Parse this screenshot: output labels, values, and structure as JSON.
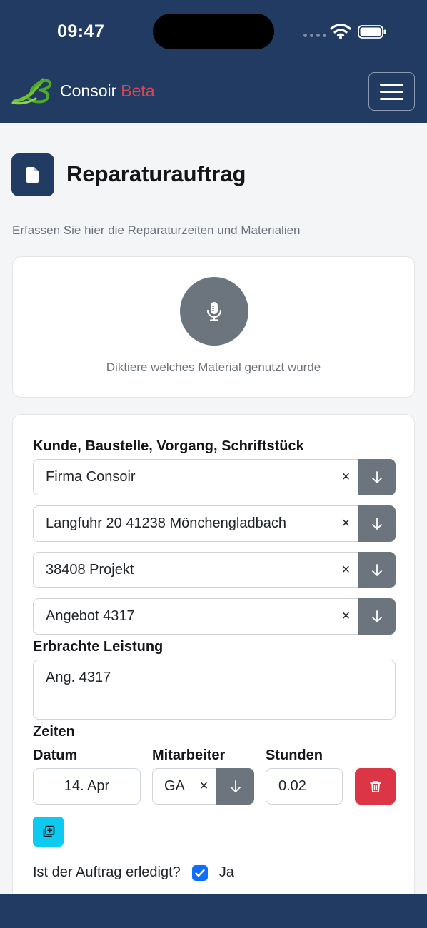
{
  "status_bar": {
    "time": "09:47"
  },
  "navbar": {
    "brand_name": "Consoir",
    "brand_tag": "Beta",
    "menu_icon": "hamburger-menu-icon",
    "colors": {
      "navbar": "#213b63",
      "beta": "#e0434f"
    }
  },
  "header": {
    "icon": "document-icon",
    "title": "Reparaturauftrag",
    "subtitle": "Erfassen Sie hier die Reparaturzeiten und Materialien"
  },
  "dictation": {
    "icon": "microphone-icon",
    "hint": "Diktiere welches Material genutzt wurde"
  },
  "form": {
    "context_label": "Kunde, Baustelle, Vorgang, Schriftstück",
    "context_fields": [
      {
        "value": "Firma Consoir"
      },
      {
        "value": "Langfuhr 20 41238 Mönchengladbach"
      },
      {
        "value": "38408 Projekt"
      },
      {
        "value": "Angebot 4317"
      }
    ],
    "clear_symbol": "×",
    "service_label": "Erbrachte Leistung",
    "service_value": "Ang. 4317",
    "times_label": "Zeiten",
    "columns": {
      "date": "Datum",
      "employee": "Mitarbeiter",
      "hours": "Stunden"
    },
    "time_entry": {
      "date": "14. Apr",
      "employee": "GA",
      "hours": "0.02"
    },
    "done_question": "Ist der Auftrag erledigt?",
    "done_checked": true,
    "done_answer": "Ja",
    "colors": {
      "delete": "#dc3545",
      "add": "#0dcaf0",
      "checkbox": "#0d6efd",
      "dropdown": "#6c757d"
    }
  }
}
